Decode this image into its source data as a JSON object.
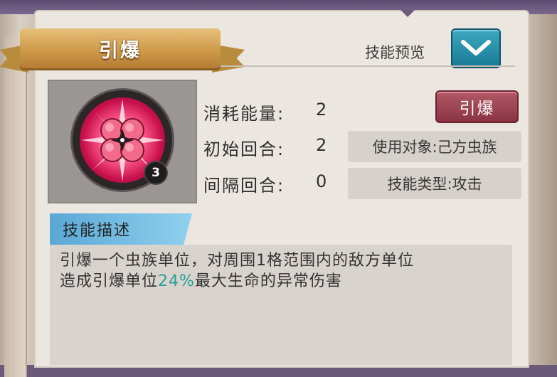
{
  "skill": {
    "title": "引爆",
    "preview_label": "技能预览",
    "icon_name": "detonate-orb-icon",
    "stack_count": "3"
  },
  "stats": [
    {
      "label": "消耗能量:",
      "value": "2"
    },
    {
      "label": "初始回合:",
      "value": "2"
    },
    {
      "label": "间隔回合:",
      "value": "0"
    }
  ],
  "action_button": "引爆",
  "tags": {
    "target": "使用对象:己方虫族",
    "type": "技能类型:攻击"
  },
  "description": {
    "header": "技能描述",
    "line1": "引爆一个虫族单位，对周围1格范围内的敌方单位",
    "line2_prefix": "造成引爆单位",
    "line2_highlight": "24%",
    "line2_suffix": "最大生命的异常伤害"
  },
  "colors": {
    "highlight": "#2a9e98",
    "preview_button": "#2a8ea8",
    "action_button": "#9c4452",
    "ribbon": "#d6a556"
  }
}
